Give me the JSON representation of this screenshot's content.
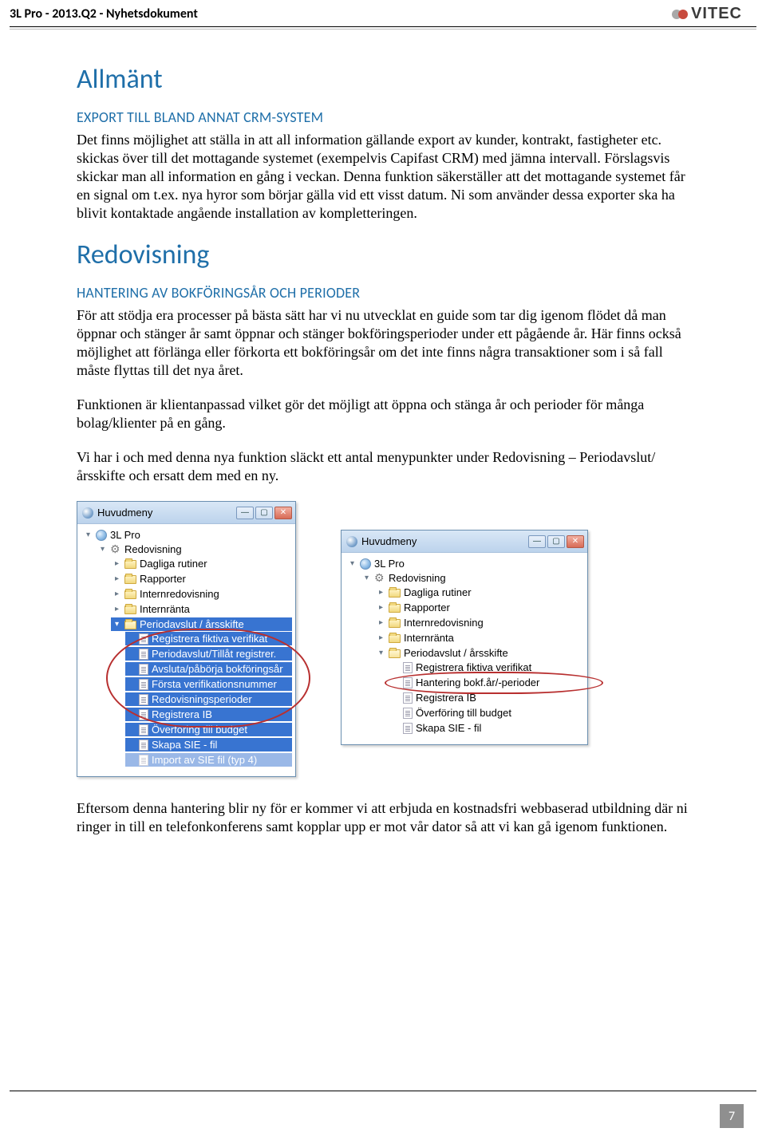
{
  "header": {
    "doc_title": "3L Pro - 2013.Q2 - Nyhetsdokument",
    "logo_text": "VITEC"
  },
  "section1": {
    "title": "Allmänt",
    "sub": "EXPORT TILL BLAND ANNAT CRM-SYSTEM",
    "p1": "Det finns möjlighet att ställa in att all information gällande export av kunder, kontrakt, fastigheter etc. skickas över till det mottagande systemet (exempelvis Capifast CRM) med jämna intervall. Förslagsvis skickar man all information en gång i veckan. Denna funktion säkerställer att det mottagande systemet får en signal om t.ex. nya hyror som börjar gälla vid ett visst datum. Ni som använder dessa exporter ska ha blivit kontaktade angående installation av kompletteringen."
  },
  "section2": {
    "title": "Redovisning",
    "sub": "HANTERING AV BOKFÖRINGSÅR OCH PERIODER",
    "p1": "För att stödja era processer på bästa sätt har vi nu utvecklat en guide som tar dig igenom flödet då man öppnar och stänger år samt öppnar och stänger bokföringsperioder under ett pågående år. Här finns också möjlighet att förlänga eller förkorta ett bokföringsår om det inte finns några transaktioner som i så fall måste flyttas till det nya året.",
    "p2": "Funktionen är klientanpassad vilket gör det möjligt att öppna och stänga år och perioder för många bolag/klienter på en gång.",
    "p3": "Vi har i och med denna nya funktion släckt ett antal menypunkter under Redovisning – Periodavslut/årsskifte och ersatt dem med en ny."
  },
  "tree_left": {
    "title": "Huvudmeny",
    "root": "3L Pro",
    "redovisning": "Redovisning",
    "items_top": [
      "Dagliga rutiner",
      "Rapporter",
      "Internredovisning",
      "Internränta"
    ],
    "selected": "Periodavslut / årsskifte",
    "sub_items": [
      "Registrera fiktiva verifikat",
      "Periodavslut/Tillåt registrer.",
      "Avsluta/påbörja bokföringsår",
      "Första verifikationsnummer",
      "Redovisningsperioder",
      "Registrera IB",
      "Överföring till budget",
      "Skapa SIE - fil",
      "Import av SIE fil (typ 4)"
    ]
  },
  "tree_right": {
    "title": "Huvudmeny",
    "root": "3L Pro",
    "redovisning": "Redovisning",
    "items_top": [
      "Dagliga rutiner",
      "Rapporter",
      "Internredovisning",
      "Internränta"
    ],
    "folder_open": "Periodavslut / årsskifte",
    "sub_items": [
      "Registrera fiktiva verifikat",
      "Hantering bokf.år/-perioder",
      "Registrera IB",
      "Överföring till budget",
      "Skapa SIE - fil"
    ]
  },
  "section3": {
    "p1": "Eftersom denna hantering blir ny för er kommer vi att erbjuda en kostnadsfri webbaserad utbildning där ni ringer in till en telefonkonferens samt kopplar upp er mot vår dator så att vi kan gå igenom funktionen."
  },
  "page_number": "7"
}
